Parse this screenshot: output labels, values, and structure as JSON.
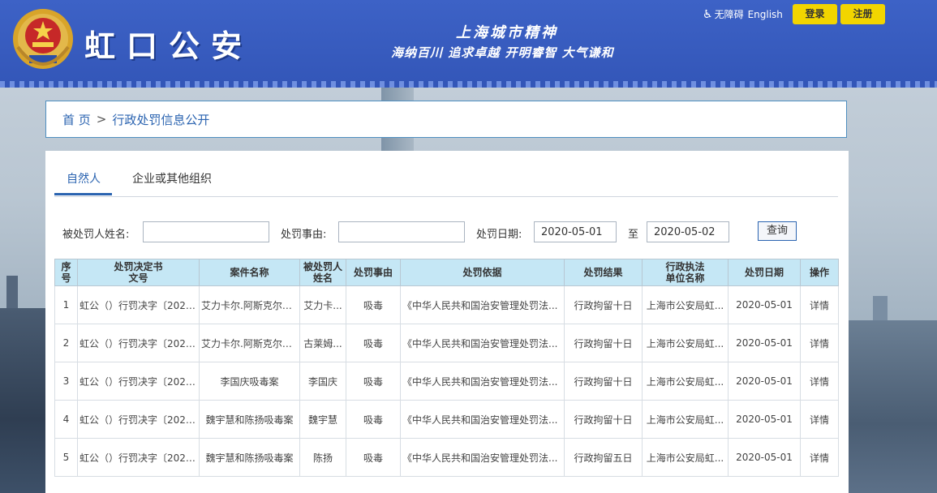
{
  "header": {
    "site_name": "虹口公安",
    "slogan_line1": "上海城市精神",
    "slogan_line2": "海纳百川 追求卓越 开明睿智 大气谦和",
    "accessibility_label": "无障碍",
    "english_label": "English",
    "login_label": "登录",
    "register_label": "注册",
    "accent_color": "#3356b8",
    "button_color": "#f2d500"
  },
  "breadcrumb": {
    "home": "首 页",
    "separator": ">",
    "current": "行政处罚信息公开"
  },
  "tabs": [
    {
      "label": "自然人",
      "active": true
    },
    {
      "label": "企业或其他组织",
      "active": false
    }
  ],
  "filters": {
    "name_label": "被处罚人姓名:",
    "name_value": "",
    "reason_label": "处罚事由:",
    "reason_value": "",
    "date_label": "处罚日期:",
    "date_from": "2020-05-01",
    "date_to_label": "至",
    "date_to": "2020-05-02",
    "search_label": "查询"
  },
  "table": {
    "headers": [
      "序号",
      "处罚决定书\n文号",
      "案件名称",
      "被处罚人\n姓名",
      "处罚事由",
      "处罚依据",
      "处罚结果",
      "行政执法\n单位名称",
      "处罚日期",
      "操作"
    ],
    "rows": [
      [
        "1",
        "虹公（）行罚决字〔2020...",
        "艾力卡尔.阿斯克尔等...",
        "艾力卡...",
        "吸毒",
        "《中华人民共和国治安管理处罚法...",
        "行政拘留十日",
        "上海市公安局虹...",
        "2020-05-01",
        "详情"
      ],
      [
        "2",
        "虹公（）行罚决字〔2020...",
        "艾力卡尔.阿斯克尔等...",
        "古莱姆...",
        "吸毒",
        "《中华人民共和国治安管理处罚法...",
        "行政拘留十日",
        "上海市公安局虹...",
        "2020-05-01",
        "详情"
      ],
      [
        "3",
        "虹公（）行罚决字〔2020...",
        "李国庆吸毒案",
        "李国庆",
        "吸毒",
        "《中华人民共和国治安管理处罚法...",
        "行政拘留十日",
        "上海市公安局虹...",
        "2020-05-01",
        "详情"
      ],
      [
        "4",
        "虹公（）行罚决字〔2020...",
        "魏宇慧和陈扬吸毒案",
        "魏宇慧",
        "吸毒",
        "《中华人民共和国治安管理处罚法...",
        "行政拘留十日",
        "上海市公安局虹...",
        "2020-05-01",
        "详情"
      ],
      [
        "5",
        "虹公（）行罚决字〔2020...",
        "魏宇慧和陈扬吸毒案",
        "陈扬",
        "吸毒",
        "《中华人民共和国治安管理处罚法...",
        "行政拘留五日",
        "上海市公安局虹...",
        "2020-05-01",
        "详情"
      ]
    ]
  }
}
